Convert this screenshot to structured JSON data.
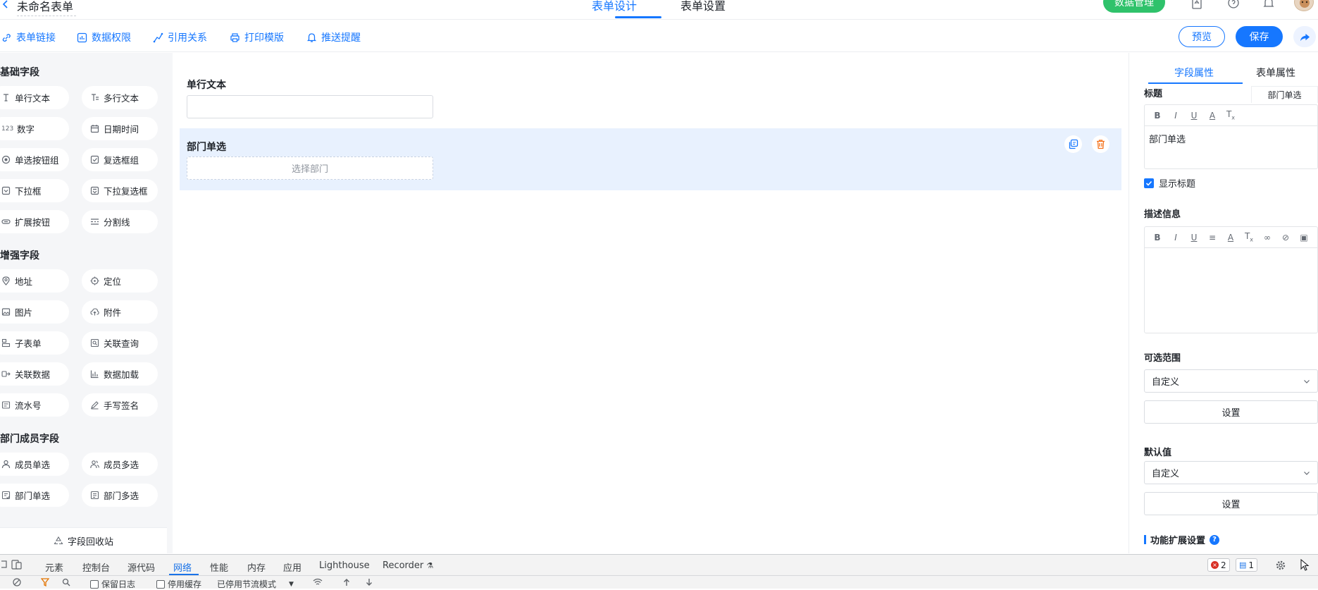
{
  "header": {
    "form_name": "未命名表单",
    "tabs": [
      "表单设计",
      "表单设置"
    ],
    "data_mgmt_label": "数据管理"
  },
  "toolbar": {
    "items": [
      "表单链接",
      "数据权限",
      "引用关系",
      "打印模版",
      "推送提醒"
    ],
    "preview_label": "预览",
    "save_label": "保存"
  },
  "palette": {
    "groups": [
      {
        "title": "基础字段",
        "fields": [
          "单行文本",
          "多行文本",
          "数字",
          "日期时间",
          "单选按钮组",
          "复选框组",
          "下拉框",
          "下拉复选框",
          "扩展按钮",
          "分割线"
        ]
      },
      {
        "title": "增强字段",
        "fields": [
          "地址",
          "定位",
          "图片",
          "附件",
          "子表单",
          "关联查询",
          "关联数据",
          "数据加载",
          "流水号",
          "手写签名"
        ]
      },
      {
        "title": "部门成员字段",
        "fields": [
          "成员单选",
          "成员多选",
          "部门单选",
          "部门多选"
        ]
      }
    ],
    "number_badge": "123",
    "recycle_label": "字段回收站"
  },
  "canvas": {
    "fields": [
      {
        "label": "单行文本",
        "placeholder": ""
      },
      {
        "label": "部门单选",
        "placeholder": "选择部门"
      }
    ]
  },
  "right_panel": {
    "tabs": [
      "字段属性",
      "表单属性"
    ],
    "title_label": "标题",
    "title_tag": "部门单选",
    "title_value": "部门单选",
    "show_title_label": "显示标题",
    "description_label": "描述信息",
    "range_label": "可选范围",
    "range_value": "自定义",
    "range_button": "设置",
    "default_label": "默认值",
    "default_value": "自定义",
    "default_button": "设置",
    "extension_label": "功能扩展设置",
    "help_glyph": "?"
  },
  "devtools": {
    "tabs": [
      "元素",
      "控制台",
      "源代码",
      "网络",
      "性能",
      "内存",
      "应用",
      "Lighthouse",
      "Recorder"
    ],
    "errors_count": "2",
    "messages_count": "1",
    "preserve_log": "保留日志",
    "disable_cache": "停用缓存",
    "throttle": "已停用节流模式"
  },
  "colors": {
    "accent": "#1677ff",
    "success": "#2fc26b",
    "danger": "#f5721c",
    "selected_bg": "#e8f1fe"
  }
}
